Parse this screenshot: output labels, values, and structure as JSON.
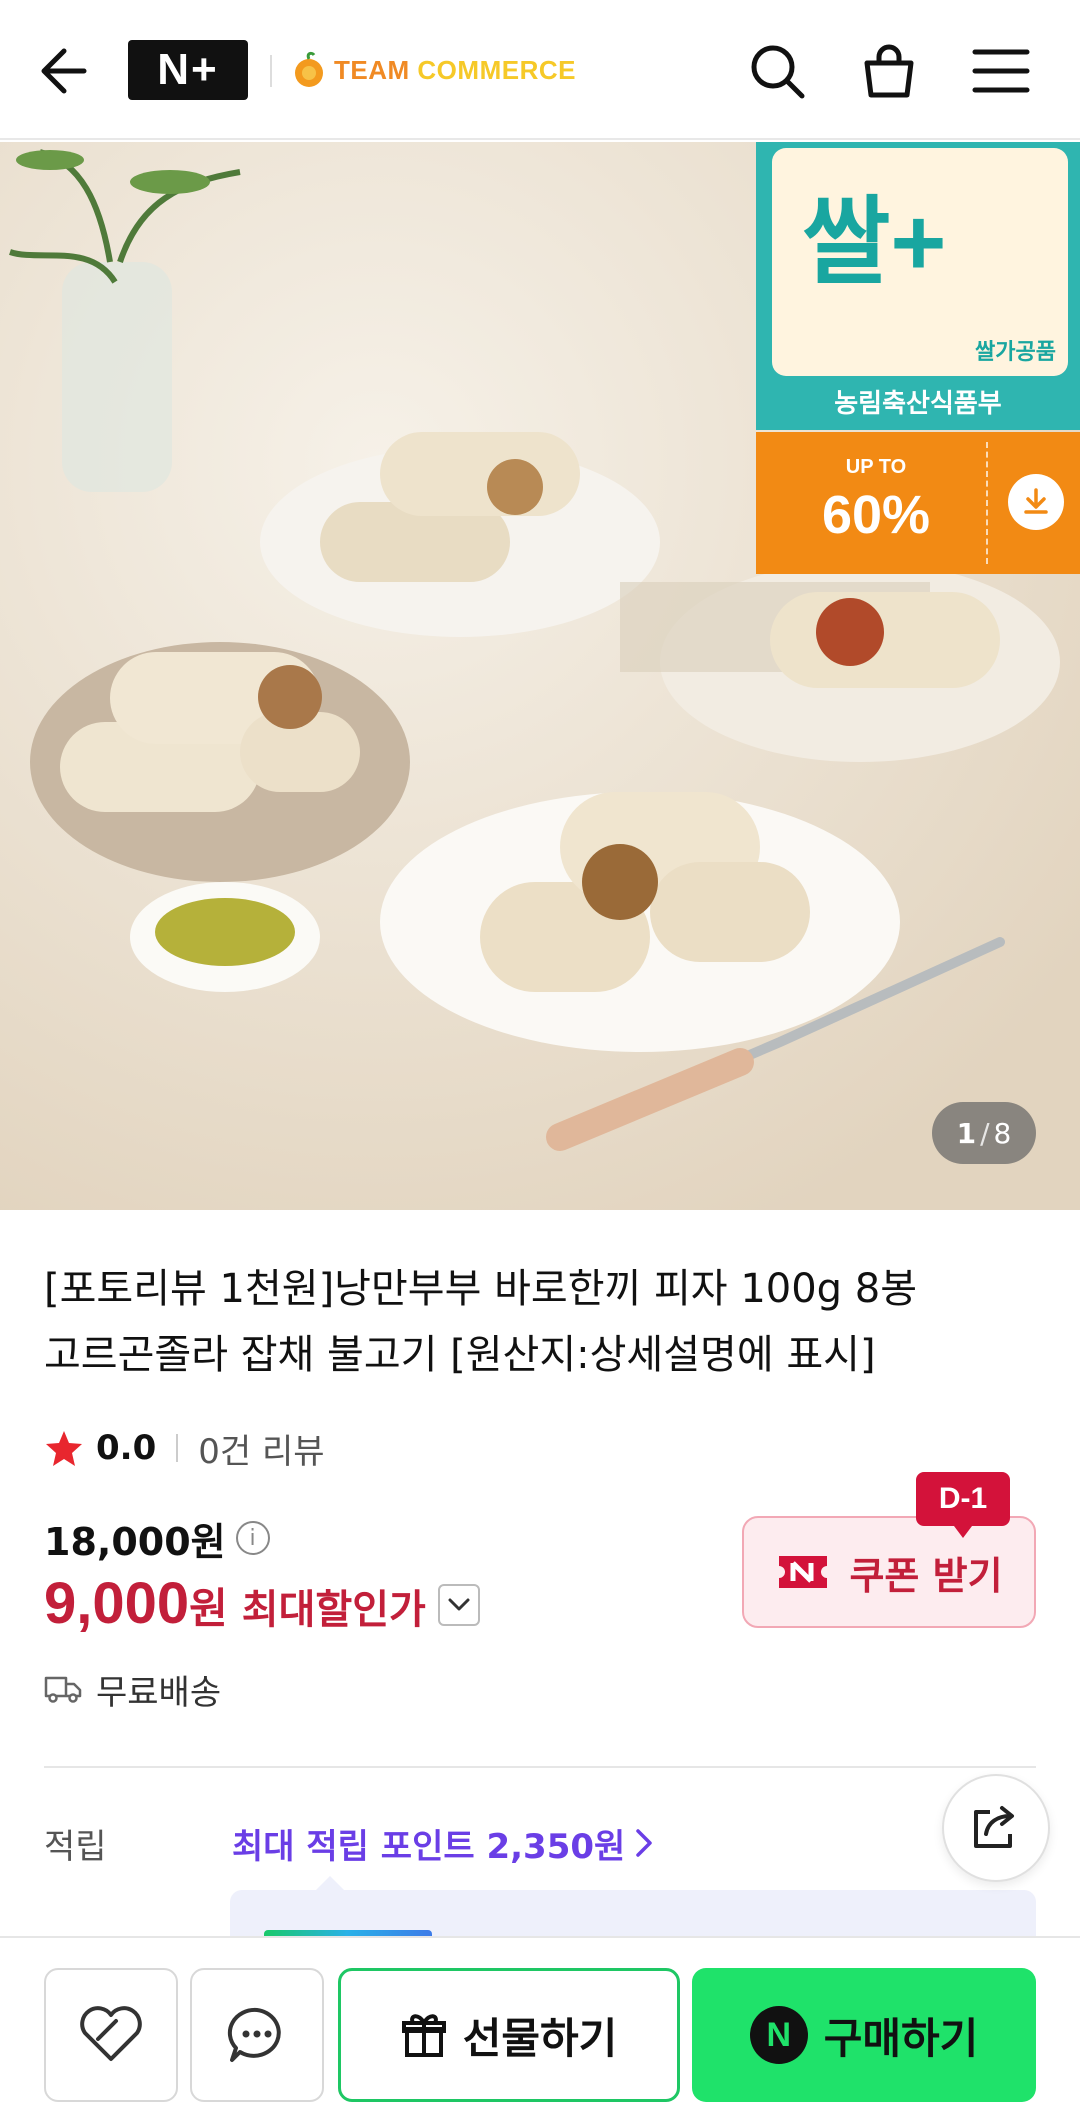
{
  "header": {
    "np_logo_text": "N+",
    "team_logo_word1": "TEAM",
    "team_logo_word2": "COMMERCE",
    "icons": [
      "back-arrow-icon",
      "search-icon",
      "cart-icon",
      "menu-icon"
    ]
  },
  "hero": {
    "badge_ssal_title": "쌀+",
    "badge_ssal_sub": "쌀가공품",
    "badge_ssal_footer": "농림축산식품부",
    "promo_label": "UP TO",
    "promo_value": "60%",
    "page_current": "1",
    "page_sep": "/",
    "page_total": "8"
  },
  "product": {
    "title_line1": "[포토리뷰 1천원]낭만부부 바로한끼 피자 100g 8봉",
    "title_line2": "고르곤졸라 잡채 불고기 [원산지:상세설명에 표시]",
    "rating": "0.0",
    "review_count": "0건 리뷰",
    "original_price": "18,000원",
    "info_icon_text": "i",
    "sale_amount": "9,000",
    "sale_won": "원",
    "sale_label": "최대할인가",
    "coupon_label": "쿠폰 받기",
    "coupon_badge": "D-1",
    "shipping": "무료배송",
    "points_label": "적립",
    "points_value": "최대 적립 포인트 2,350원"
  },
  "bottom_bar": {
    "gift_label": "선물하기",
    "buy_label": "구매하기",
    "buy_badge": "N"
  },
  "colors": {
    "sale_red": "#c21f3a",
    "points_purple": "#6a3ee6",
    "buy_green": "#1fe26a",
    "promo_orange": "#f28a14",
    "badge_teal": "#2fb5b0"
  }
}
